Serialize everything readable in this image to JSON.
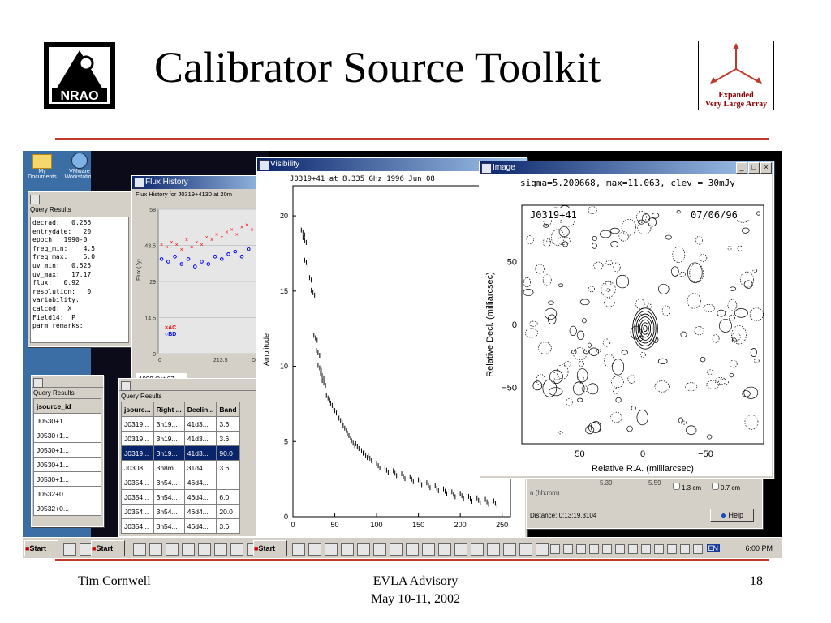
{
  "slide": {
    "title": "Calibrator Source Toolkit",
    "logo_left_text": "NRAO",
    "logo_right_line1": "Expanded",
    "logo_right_line2": "Very Large Array",
    "footer_left": "Tim Cornwell",
    "footer_center_line1": "EVLA Advisory",
    "footer_center_line2": "May 10-11, 2002",
    "footer_right": "18"
  },
  "colors": {
    "accent_rule": "#c0392b",
    "titlebar": "#0a246a"
  },
  "desktop_icons": [
    {
      "label": "My Documents",
      "icon": "folder-icon"
    },
    {
      "label": "VMware Workstation",
      "icon": "vmware-icon"
    }
  ],
  "query_results_top": {
    "header": "Query Results",
    "fields": [
      "decrad:   0.256",
      "entrydate:   20",
      "epoch:  1990-0",
      "freq_min:    4.5",
      "freq_max:    5.0",
      "uv_min:   0.525",
      "uv_max:   17.17",
      "flux:   0.92",
      "resolution:   0",
      "variability:",
      "calcod:  X",
      "Field14:  P",
      "parm_remarks:"
    ]
  },
  "flux_history": {
    "title": "Flux History",
    "subtitle": "Flux History for J0319+4130 at 20m",
    "ylabel": "Flux (Jy)",
    "xlabel": "Days si",
    "yticks": [
      "58",
      "43.5",
      "29",
      "14.5",
      "0"
    ],
    "xticks": [
      "0",
      "213.5"
    ],
    "legend": [
      "AC",
      "BD"
    ],
    "date_field": "1999 Oct 07"
  },
  "query_results_left": {
    "header": "Query Results",
    "column": "jsource_id",
    "rows": [
      "J0530+1...",
      "J0530+1...",
      "J0530+1...",
      "J0530+1...",
      "J0530+1...",
      "J0532+0...",
      "J0532+0..."
    ]
  },
  "query_results_mid": {
    "header": "Query Results",
    "columns": [
      "jsourc...",
      "Right ...",
      "Declin...",
      "Band"
    ],
    "rows": [
      [
        "J0319...",
        "3h19...",
        "41d3...",
        "3.6"
      ],
      [
        "J0319...",
        "3h19...",
        "41d3...",
        "3.6"
      ],
      [
        "J0319...",
        "3h19...",
        "41d3...",
        "90.0"
      ],
      [
        "J0308...",
        "3h8m...",
        "31d4...",
        "3.6"
      ],
      [
        "J0354...",
        "3h54...",
        "46d4...",
        ""
      ],
      [
        "J0354...",
        "3h54...",
        "46d4...",
        "6.0"
      ],
      [
        "J0354...",
        "3h54...",
        "46d4...",
        "20.0"
      ],
      [
        "J0354...",
        "3h54...",
        "46d4...",
        "3.6"
      ]
    ],
    "selected_row": 2
  },
  "visibility": {
    "title": "Visibility",
    "header": "J0319+41 at 8.335 GHz 1996 Jun 08",
    "ylabel": "Amplitude",
    "yticks": [
      "0",
      "5",
      "10",
      "15",
      "20"
    ],
    "xticks": [
      "0",
      "50",
      "100",
      "150",
      "200",
      "250"
    ]
  },
  "image_window": {
    "title": "Image",
    "header": "sigma=5.200668, max=11.063, clev = 30mJy",
    "source": "J0319+41",
    "date": "07/06/96",
    "ylabel": "Relative Decl. (milliarcsec)",
    "xlabel": "Relative R.A. (milliarcsec)",
    "yticks": [
      "50",
      "0",
      "−50"
    ],
    "xticks": [
      "50",
      "0",
      "−50"
    ]
  },
  "rx_panel": {
    "unit_label": "n (hh:mm)",
    "val1": "5.39",
    "val2": "5.59",
    "opt1": "1.3 cm",
    "opt2": "0.7 cm",
    "distance": "Distance: 0:13:19.3104",
    "help": "Help"
  },
  "taskbar": {
    "start1": "Start",
    "start2": "Start",
    "start3": "Start",
    "clock": "6:00 PM",
    "lang": "EN"
  },
  "chart_data": [
    {
      "type": "scatter",
      "title": "Flux History for J0319+4130 at 20m",
      "ylabel": "Flux (Jy)",
      "ylim": [
        0,
        58
      ],
      "series": [
        {
          "name": "AC",
          "color": "#ff0000",
          "x": [
            2,
            8,
            14,
            20,
            26,
            32,
            38,
            44,
            50,
            56,
            62,
            68,
            74,
            80,
            86,
            92,
            98,
            104,
            110,
            116,
            122,
            128
          ],
          "y": [
            44,
            43,
            45,
            44,
            42,
            46,
            43,
            45,
            44,
            47,
            46,
            48,
            47,
            49,
            50,
            48,
            51,
            52,
            50,
            53,
            54,
            55
          ]
        },
        {
          "name": "BD",
          "color": "#0000ff",
          "x": [
            2,
            10,
            18,
            26,
            34,
            42,
            50,
            58,
            66,
            74,
            82,
            90,
            98,
            106
          ],
          "y": [
            38,
            37,
            39,
            36,
            38,
            35,
            37,
            36,
            39,
            38,
            40,
            41,
            39,
            42
          ]
        }
      ]
    },
    {
      "type": "scatter",
      "title": "J0319+41 at 8.335 GHz 1996 Jun 08",
      "ylabel": "Amplitude",
      "xlim": [
        0,
        260
      ],
      "ylim": [
        0,
        22
      ],
      "x": [
        10,
        12,
        14,
        18,
        22,
        25,
        28,
        30,
        33,
        35,
        40,
        45,
        50,
        55,
        60,
        65,
        70,
        75,
        80,
        85,
        90,
        100,
        110,
        120,
        130,
        140,
        150,
        160,
        170,
        180,
        190,
        200,
        210,
        220,
        230,
        240
      ],
      "y": [
        19,
        18.5,
        17,
        16,
        15,
        12,
        11,
        10,
        9.5,
        9,
        8,
        7.5,
        7,
        6.5,
        6,
        5.5,
        5,
        4.8,
        4.5,
        4.2,
        4,
        3.5,
        3.2,
        3,
        2.8,
        2.6,
        2.4,
        2.2,
        2,
        1.8,
        1.6,
        1.5,
        1.3,
        1.2,
        1.1,
        1.0
      ]
    }
  ]
}
